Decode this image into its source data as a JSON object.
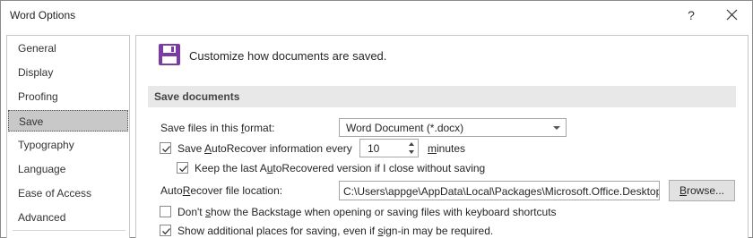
{
  "window": {
    "title": "Word Options",
    "help_glyph": "?"
  },
  "sidebar": {
    "items": [
      {
        "label": "General"
      },
      {
        "label": "Display"
      },
      {
        "label": "Proofing"
      },
      {
        "label": "Save",
        "selected": true
      },
      {
        "label": "Typography"
      },
      {
        "label": "Language"
      },
      {
        "label": "Ease of Access"
      },
      {
        "label": "Advanced"
      }
    ]
  },
  "main": {
    "heading": "Customize how documents are saved.",
    "heading_icon": "save-icon",
    "section": "Save documents",
    "format_label_a": "Save files in this ",
    "format_label_u": "f",
    "format_label_b": "ormat:",
    "format_value": "Word Document (*.docx)",
    "autorecover_a": "Save ",
    "autorecover_u": "A",
    "autorecover_b": "utoRecover information every",
    "autorecover_checked": true,
    "autorecover_minutes": "10",
    "minutes_u": "m",
    "minutes_b": "inutes",
    "keep_a": "Keep the last A",
    "keep_u": "u",
    "keep_b": "toRecovered version if I close without saving",
    "keep_checked": true,
    "location_a": "Auto",
    "location_u": "R",
    "location_b": "ecover file location:",
    "location_value": "C:\\Users\\appge\\AppData\\Local\\Packages\\Microsoft.Office.Desktop",
    "browse_a": "B",
    "browse_b": "rowse...",
    "backstage_a": "Don't ",
    "backstage_u": "s",
    "backstage_b": "how the Backstage when opening or saving files with keyboard shortcuts",
    "backstage_checked": false,
    "additional_a": "Show additional places for saving, even if ",
    "additional_u": "s",
    "additional_b": "ign-in may be required.",
    "additional_checked": true
  },
  "colors": {
    "accent_save_icon": "#7b3aa8",
    "selected_nav": "#c8c8c8",
    "section_bar": "#e8e8e8"
  }
}
